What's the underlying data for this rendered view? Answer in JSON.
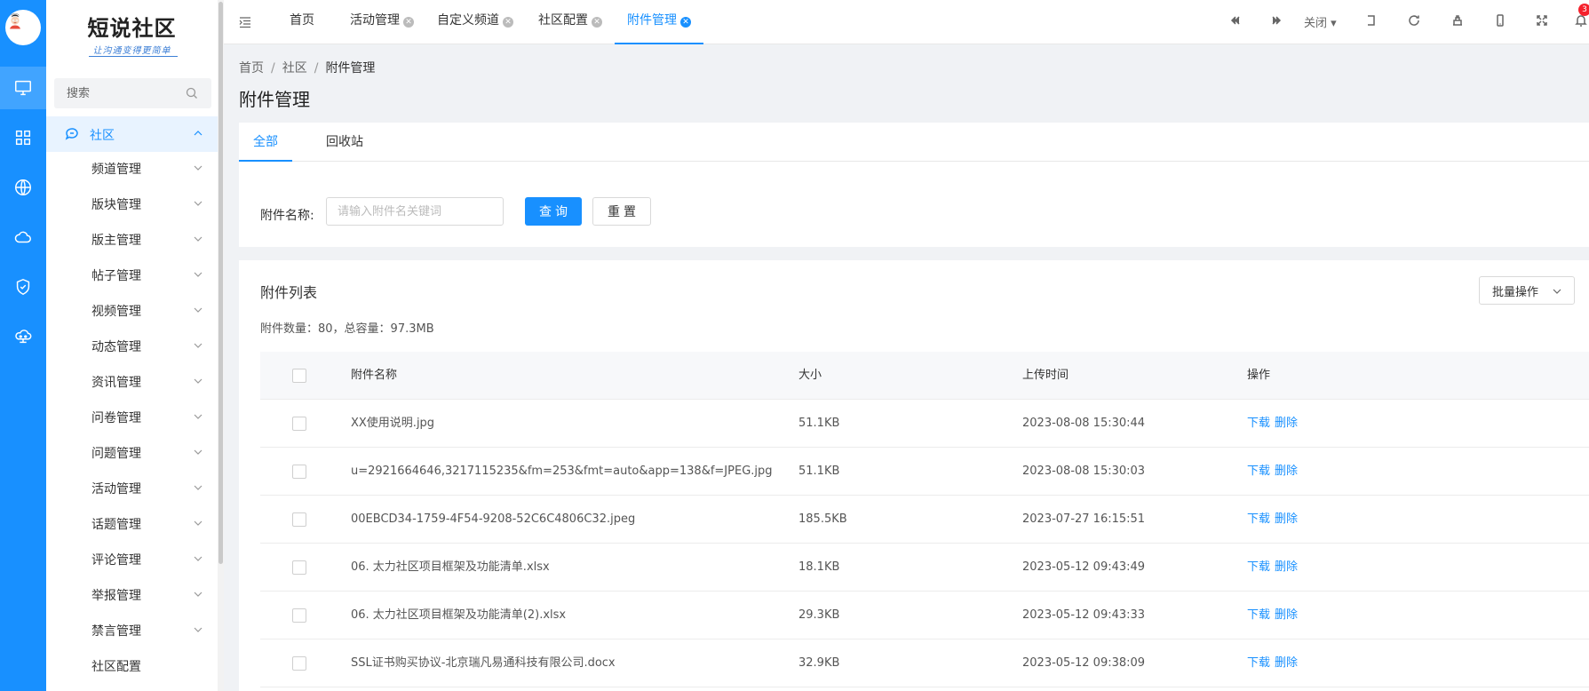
{
  "brand": {
    "name": "短说社区",
    "slogan": "让沟通变得更简单"
  },
  "sidebar": {
    "search_placeholder": "搜索",
    "group_label": "社区",
    "items": [
      {
        "label": "频道管理"
      },
      {
        "label": "版块管理"
      },
      {
        "label": "版主管理"
      },
      {
        "label": "帖子管理"
      },
      {
        "label": "视频管理"
      },
      {
        "label": "动态管理"
      },
      {
        "label": "资讯管理"
      },
      {
        "label": "问卷管理"
      },
      {
        "label": "问题管理"
      },
      {
        "label": "活动管理"
      },
      {
        "label": "话题管理"
      },
      {
        "label": "评论管理"
      },
      {
        "label": "举报管理"
      },
      {
        "label": "禁言管理"
      },
      {
        "label": "社区配置"
      }
    ]
  },
  "rail_icons": [
    "monitor-icon",
    "grid-icon",
    "globe-icon",
    "cloud-icon",
    "shield-icon",
    "cloud-network-icon"
  ],
  "tabs": [
    {
      "label": "首页"
    },
    {
      "label": "活动管理"
    },
    {
      "label": "自定义频道"
    },
    {
      "label": "社区配置"
    },
    {
      "label": "附件管理"
    }
  ],
  "toolbar": {
    "close_label": "关闭",
    "notification_count": "3"
  },
  "breadcrumb": {
    "home": "首页",
    "section": "社区",
    "current": "附件管理"
  },
  "page_title": "附件管理",
  "subtabs": [
    {
      "label": "全部"
    },
    {
      "label": "回收站"
    }
  ],
  "filter": {
    "label": "附件名称:",
    "placeholder": "请输入附件名关键词",
    "query_button": "查询",
    "reset_button": "重置"
  },
  "list": {
    "title": "附件列表",
    "batch_button": "批量操作",
    "summary": "附件数量：80，总容量：97.3MB",
    "columns": {
      "name": "附件名称",
      "size": "大小",
      "time": "上传时间",
      "action": "操作"
    },
    "download_label": "下载",
    "delete_label": "删除",
    "rows": [
      {
        "name": "XX使用说明.jpg",
        "size": "51.1KB",
        "time": "2023-08-08 15:30:44"
      },
      {
        "name": "u=2921664646,3217115235&fm=253&fmt=auto&app=138&f=JPEG.jpg",
        "size": "51.1KB",
        "time": "2023-08-08 15:30:03"
      },
      {
        "name": "00EBCD34-1759-4F54-9208-52C6C4806C32.jpeg",
        "size": "185.5KB",
        "time": "2023-07-27 16:15:51"
      },
      {
        "name": "06. 太力社区项目框架及功能清单.xlsx",
        "size": "18.1KB",
        "time": "2023-05-12 09:43:49"
      },
      {
        "name": "06. 太力社区项目框架及功能清单(2).xlsx",
        "size": "29.3KB",
        "time": "2023-05-12 09:43:33"
      },
      {
        "name": "SSL证书购买协议-北京瑞凡易通科技有限公司.docx",
        "size": "32.9KB",
        "time": "2023-05-12 09:38:09"
      }
    ]
  },
  "colors": {
    "primary": "#1890ff",
    "rail": "#1890ff",
    "badge": "#f5222d"
  }
}
